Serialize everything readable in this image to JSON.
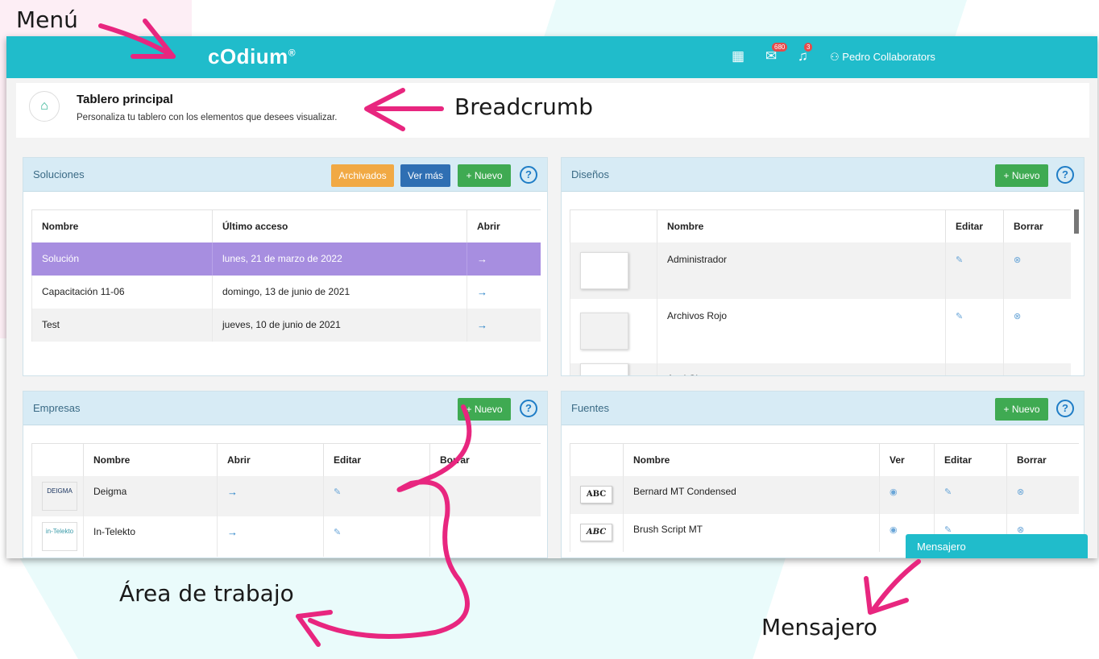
{
  "annotations": {
    "menu": "Menú",
    "breadcrumb": "Breadcrumb",
    "workspace": "Área de trabajo",
    "messenger": "Mensajero"
  },
  "topbar": {
    "logo": "cOdium",
    "logo_mark": "®",
    "mail_count": "680",
    "notif_count": "3",
    "user_name": "Pedro Collaborators"
  },
  "breadcrumb": {
    "title": "Tablero principal",
    "subtitle": "Personaliza tu tablero con los elementos que desees visualizar."
  },
  "soluciones": {
    "title": "Soluciones",
    "btn_archived": "Archivados",
    "btn_more": "Ver más",
    "btn_new": "+ Nuevo",
    "help": "?",
    "headers": [
      "Nombre",
      "Último acceso",
      "Abrir"
    ],
    "rows": [
      {
        "name": "Solución",
        "date": "lunes, 21 de marzo de 2022",
        "open": "→"
      },
      {
        "name": "Capacitación 11-06",
        "date": "domingo, 13 de junio de 2021",
        "open": "→"
      },
      {
        "name": "Test",
        "date": "jueves, 10 de junio de 2021",
        "open": "→"
      }
    ]
  },
  "disenos": {
    "title": "Diseños",
    "btn_new": "+ Nuevo",
    "help": "?",
    "headers": [
      "",
      "Nombre",
      "Editar",
      "Borrar"
    ],
    "rows": [
      {
        "name": "Administrador",
        "edit": "✎",
        "delete": "⊗"
      },
      {
        "name": "Archivos Rojo",
        "edit": "✎",
        "delete": "⊗"
      },
      {
        "name": "Azul Claro",
        "edit": "✎",
        "delete": "⊗"
      }
    ]
  },
  "empresas": {
    "title": "Empresas",
    "btn_new": "+ Nuevo",
    "help": "?",
    "headers": [
      "",
      "Nombre",
      "Abrir",
      "Editar",
      "Borrar"
    ],
    "rows": [
      {
        "logo": "DEIGMA",
        "name": "Deigma",
        "open": "→",
        "edit": "✎"
      },
      {
        "logo": "in-Telekto",
        "name": "In-Telekto",
        "open": "→",
        "edit": "✎"
      }
    ]
  },
  "fuentes": {
    "title": "Fuentes",
    "btn_new": "+ Nuevo",
    "help": "?",
    "headers": [
      "",
      "Nombre",
      "Ver",
      "Editar",
      "Borrar"
    ],
    "rows": [
      {
        "sample": "ABC",
        "name": "Bernard MT Condensed",
        "view": "◉",
        "edit": "✎",
        "delete": "⊗"
      },
      {
        "sample": "ABC",
        "name": "Brush Script MT",
        "view": "◉",
        "edit": "✎",
        "delete": "⊗"
      }
    ]
  },
  "messenger": {
    "label": "Mensajero"
  },
  "colors": {
    "topbar": "#20bccb",
    "accent_pink": "#e8267f",
    "selected_row": "#a78ee0",
    "btn_green": "#3faa52",
    "btn_orange": "#f1a944",
    "btn_blue": "#2f6fb3"
  }
}
